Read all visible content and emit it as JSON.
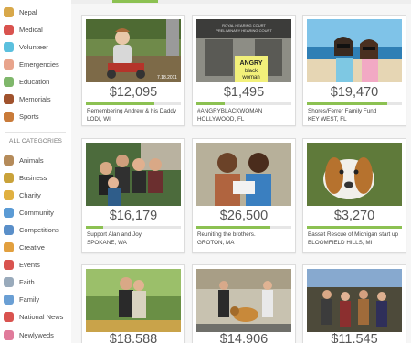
{
  "sidebar": {
    "top_items": [
      {
        "label": "Nepal",
        "icon": "nepal-flag-icon",
        "color": "#d8a84a"
      },
      {
        "label": "Medical",
        "icon": "medical-cross-icon",
        "color": "#d9534f"
      },
      {
        "label": "Volunteer",
        "icon": "heart-hands-icon",
        "color": "#5bc0de"
      },
      {
        "label": "Emergencies",
        "icon": "bandage-icon",
        "color": "#e8a48c"
      },
      {
        "label": "Education",
        "icon": "book-icon",
        "color": "#7fb76b"
      },
      {
        "label": "Memorials",
        "icon": "memorial-icon",
        "color": "#a0522d"
      },
      {
        "label": "Sports",
        "icon": "football-icon",
        "color": "#c97b3a"
      }
    ],
    "section_title": "ALL CATEGORIES",
    "all_items": [
      {
        "label": "Animals",
        "icon": "paw-icon",
        "color": "#b58b5a"
      },
      {
        "label": "Business",
        "icon": "briefcase-icon",
        "color": "#c9a23a"
      },
      {
        "label": "Charity",
        "icon": "gift-icon",
        "color": "#e0b040"
      },
      {
        "label": "Community",
        "icon": "community-icon",
        "color": "#5b9bd5"
      },
      {
        "label": "Competitions",
        "icon": "trophy-icon",
        "color": "#5a8fc9"
      },
      {
        "label": "Creative",
        "icon": "palette-icon",
        "color": "#e2a03f"
      },
      {
        "label": "Events",
        "icon": "calendar-icon",
        "color": "#d9534f"
      },
      {
        "label": "Faith",
        "icon": "dove-icon",
        "color": "#9ab"
      },
      {
        "label": "Family",
        "icon": "family-icon",
        "color": "#6a9fd4"
      },
      {
        "label": "National News",
        "icon": "flag-icon",
        "color": "#d9534f"
      },
      {
        "label": "Newlyweds",
        "icon": "rings-icon",
        "color": "#e07b9b"
      }
    ]
  },
  "campaigns": [
    {
      "amount": "$12,095",
      "title": "Remembering Andrew & his Daddy",
      "location": "LODI, WI",
      "progress": 0.72
    },
    {
      "amount": "$1,495",
      "title": "#ANGRYBLACKWOMAN",
      "location": "HOLLYWOOD, FL",
      "progress": 0.3
    },
    {
      "amount": "$19,470",
      "title": "Shores/Ferrer Family Fund",
      "location": "KEY WEST, FL",
      "progress": 0.85
    },
    {
      "amount": "$16,179",
      "title": "Support Alan and Joy",
      "location": "SPOKANE, WA",
      "progress": 0.18
    },
    {
      "amount": "$26,500",
      "title": "Reuniting the brothers.",
      "location": "GROTON, MA",
      "progress": 0.78
    },
    {
      "amount": "$3,270",
      "title": "Basset Rescue of Michigan start up",
      "location": "BLOOMFIELD HILLS, MI",
      "progress": 1.0
    },
    {
      "amount": "$18,588",
      "title": "",
      "location": "",
      "progress": 0
    },
    {
      "amount": "$14,906",
      "title": "",
      "location": "",
      "progress": 0
    },
    {
      "amount": "$11,545",
      "title": "",
      "location": "",
      "progress": 0
    }
  ],
  "photo_captions": {
    "timestamp": "7.18.2011",
    "sign_line1": "ROYAL HEARING COURT",
    "sign_line2": "PRELIMINARY HEARING COURT",
    "protest_sign1": "ANGRY",
    "protest_sign2": "black",
    "protest_sign3": "woman"
  }
}
